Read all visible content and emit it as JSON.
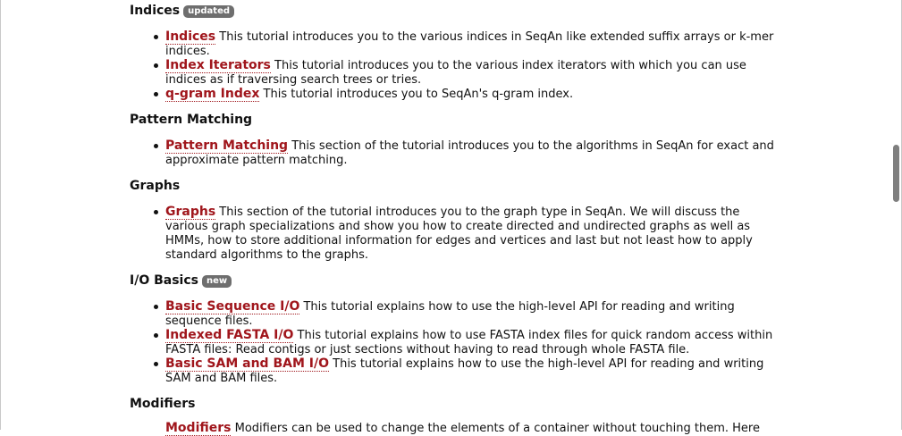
{
  "sections": [
    {
      "title": "Indices",
      "badge": "updated",
      "items": [
        {
          "link": "Indices",
          "text": " This tutorial introduces you to the various indices in SeqAn like extended suffix arrays or k-mer indices."
        },
        {
          "link": "Index Iterators",
          "text": " This tutorial introduces you to the various index iterators with which you can use indices as if traversing search trees or tries."
        },
        {
          "link": "q-gram Index",
          "text": " This tutorial introduces you to SeqAn's q-gram index."
        }
      ]
    },
    {
      "title": "Pattern Matching",
      "items": [
        {
          "link": "Pattern Matching",
          "text": " This section of the tutorial introduces you to the algorithms in SeqAn for exact and approximate pattern matching."
        }
      ]
    },
    {
      "title": "Graphs",
      "items": [
        {
          "link": "Graphs",
          "text": " This section of the tutorial introduces you to the graph type in SeqAn. We will discuss the various graph specializations and show you how to create directed and undirected graphs as well as HMMs, how to store additional information for edges and vertices and last but not least how to apply standard algorithms to the graphs."
        }
      ]
    },
    {
      "title": "I/O Basics",
      "badge": "new",
      "items": [
        {
          "link": "Basic Sequence I/O",
          "text": " This tutorial explains how to use the high-level API for reading and writing sequence files."
        },
        {
          "link": "Indexed FASTA I/O",
          "text": " This tutorial explains how to use FASTA index files for quick random access within FASTA files: Read contigs or just sections without having to read through whole FASTA file."
        },
        {
          "link": "Basic SAM and BAM I/O",
          "text": " This tutorial explains how to use the high-level API for reading and writing SAM and BAM files."
        }
      ]
    },
    {
      "title": "Modifiers",
      "items": [
        {
          "link": "Modifiers",
          "text": " Modifiers can be used to change the elements of a container without touching them. Here"
        }
      ]
    }
  ]
}
